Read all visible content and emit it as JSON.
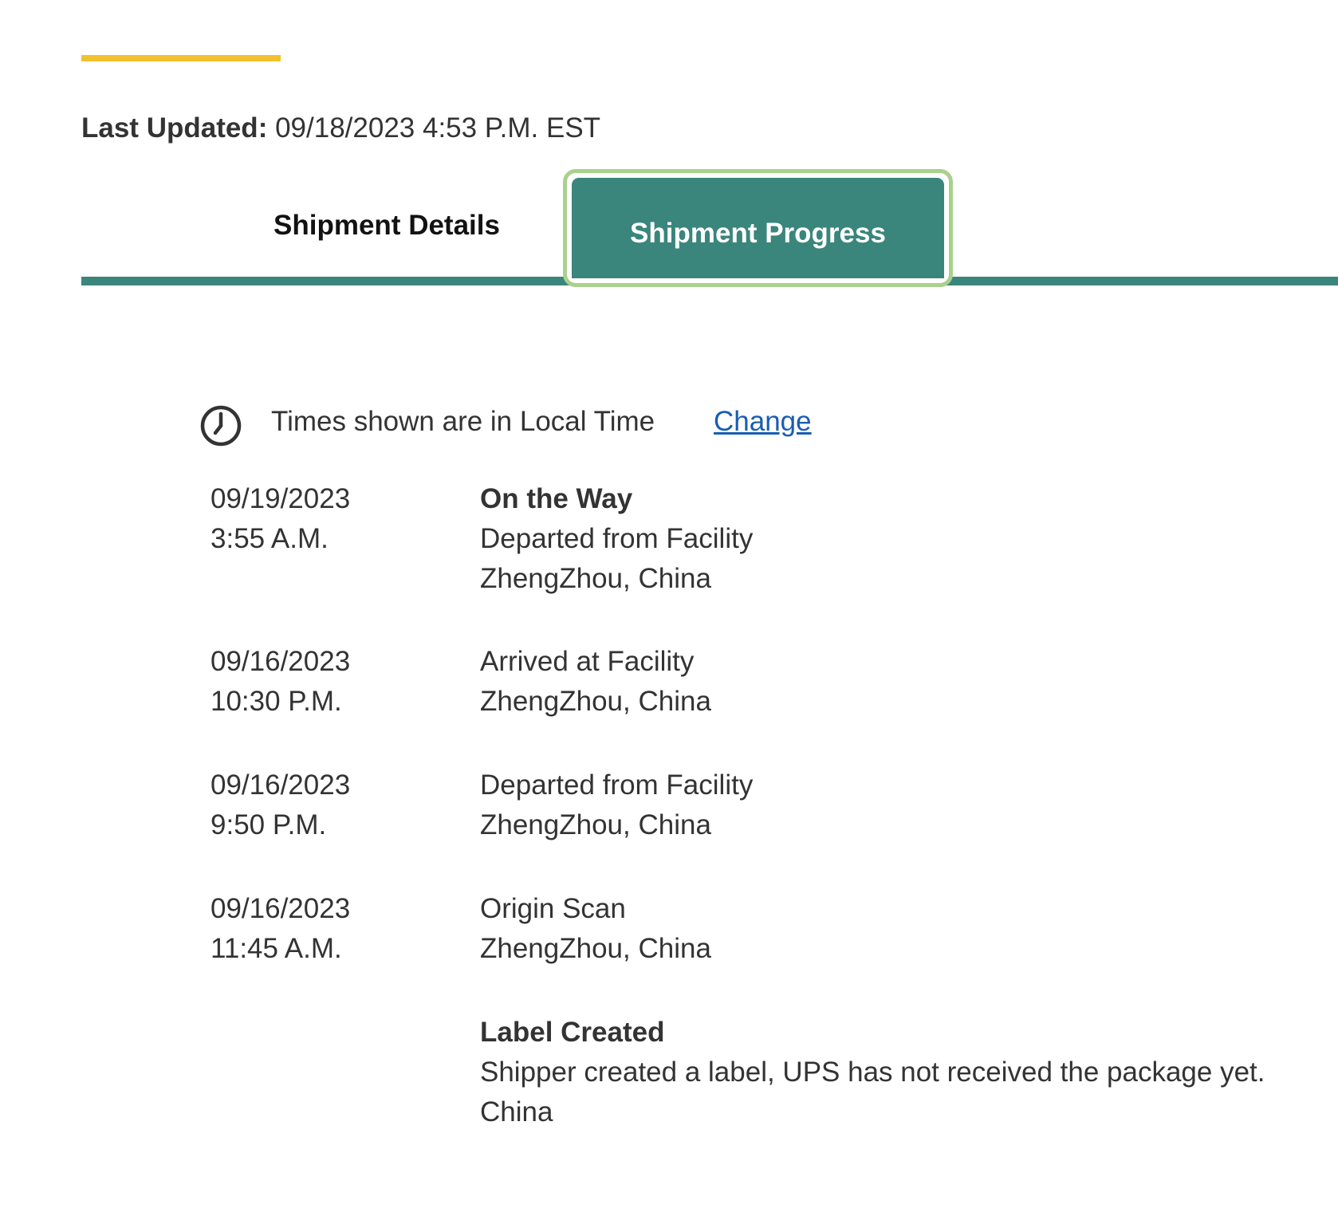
{
  "last_updated": {
    "label": "Last Updated:",
    "value": "09/18/2023 4:53 P.M. EST"
  },
  "tabs": {
    "details_label": "Shipment Details",
    "progress_label": "Shipment Progress",
    "active": "Shipment Progress"
  },
  "timezone": {
    "icon": "clock-icon",
    "text": "Times shown are in Local Time",
    "change_label": "Change"
  },
  "events": [
    {
      "date": "09/19/2023",
      "time": "3:55 A.M.",
      "heading": "On the Way",
      "status": "Departed from Facility",
      "location": "ZhengZhou, China"
    },
    {
      "date": "09/16/2023",
      "time": "10:30 P.M.",
      "status": "Arrived at Facility",
      "location": "ZhengZhou, China"
    },
    {
      "date": "09/16/2023",
      "time": "9:50 P.M.",
      "status": "Departed from Facility",
      "location": "ZhengZhou, China"
    },
    {
      "date": "09/16/2023",
      "time": "11:45 A.M.",
      "status": "Origin Scan",
      "location": "ZhengZhou, China"
    },
    {
      "heading": "Label Created",
      "status": "Shipper created a label, UPS has not received the package yet.",
      "location": "China"
    }
  ],
  "colors": {
    "accent_yellow": "#F2C12E",
    "tab_green": "#3A857C",
    "focus_outline": "#A9D18E",
    "link_blue": "#1A5DB3",
    "text": "#333333"
  }
}
